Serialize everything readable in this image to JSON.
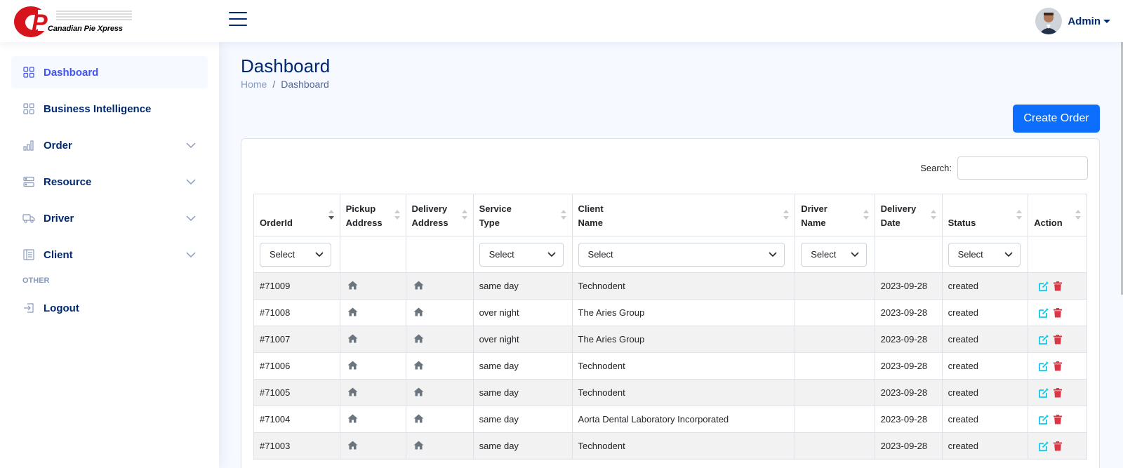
{
  "header": {
    "logo_text": "Canadian Pie Xpress",
    "user_name": "Admin"
  },
  "sidebar": {
    "items": [
      {
        "label": "Dashboard",
        "icon": "grid-icon",
        "active": true,
        "expandable": false
      },
      {
        "label": "Business Intelligence",
        "icon": "grid-icon",
        "active": false,
        "expandable": false
      },
      {
        "label": "Order",
        "icon": "bar-chart-icon",
        "active": false,
        "expandable": true
      },
      {
        "label": "Resource",
        "icon": "server-icon",
        "active": false,
        "expandable": true
      },
      {
        "label": "Driver",
        "icon": "truck-icon",
        "active": false,
        "expandable": true
      },
      {
        "label": "Client",
        "icon": "layout-text-icon",
        "active": false,
        "expandable": true
      }
    ],
    "other_heading": "OTHER",
    "logout_label": "Logout"
  },
  "page": {
    "title": "Dashboard",
    "breadcrumb_home": "Home",
    "breadcrumb_sep": "/",
    "breadcrumb_current": "Dashboard",
    "create_order_label": "Create Order"
  },
  "table": {
    "search_label": "Search:",
    "columns": [
      {
        "line1": "OrderId",
        "line2": ""
      },
      {
        "line1": "Pickup",
        "line2": "Address"
      },
      {
        "line1": "Delivery",
        "line2": "Address"
      },
      {
        "line1": "Service",
        "line2": "Type"
      },
      {
        "line1": "Client",
        "line2": "Name"
      },
      {
        "line1": "Driver",
        "line2": "Name"
      },
      {
        "line1": "Delivery",
        "line2": "Date"
      },
      {
        "line1": "Status",
        "line2": ""
      },
      {
        "line1": "Action",
        "line2": ""
      }
    ],
    "filter_placeholder": "Select",
    "rows": [
      {
        "order_id": "#71009",
        "service": "same day",
        "client": "Technodent",
        "driver": "",
        "date": "2023-09-28",
        "status": "created"
      },
      {
        "order_id": "#71008",
        "service": "over night",
        "client": "The Aries Group",
        "driver": "",
        "date": "2023-09-28",
        "status": "created"
      },
      {
        "order_id": "#71007",
        "service": "over night",
        "client": "The Aries Group",
        "driver": "",
        "date": "2023-09-28",
        "status": "created"
      },
      {
        "order_id": "#71006",
        "service": "same day",
        "client": "Technodent",
        "driver": "",
        "date": "2023-09-28",
        "status": "created"
      },
      {
        "order_id": "#71005",
        "service": "same day",
        "client": "Technodent",
        "driver": "",
        "date": "2023-09-28",
        "status": "created"
      },
      {
        "order_id": "#71004",
        "service": "same day",
        "client": "Aorta Dental Laboratory Incorporated",
        "driver": "",
        "date": "2023-09-28",
        "status": "created"
      },
      {
        "order_id": "#71003",
        "service": "same day",
        "client": "Technodent",
        "driver": "",
        "date": "2023-09-28",
        "status": "created"
      }
    ]
  },
  "colors": {
    "primary": "#0d6efd",
    "navy": "#012970",
    "active_nav": "#4154f1",
    "edit": "#0dcaf0",
    "delete": "#dc3545",
    "logo_red": "#d7141c"
  }
}
